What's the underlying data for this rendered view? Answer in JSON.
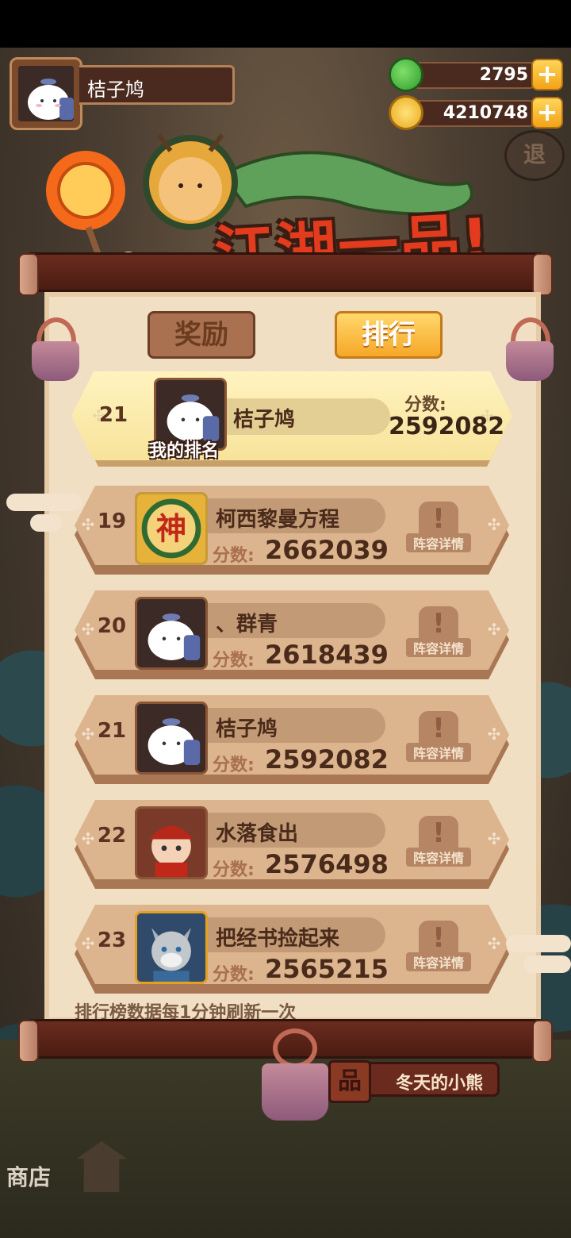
{
  "player": {
    "name": "桔子鸠"
  },
  "resources": {
    "jade": "2795",
    "coins": "4210748"
  },
  "back_label": "退",
  "banner_title": "江湖一品!",
  "tabs": {
    "reward": "奖励",
    "rank": "排行"
  },
  "my_rank": {
    "rank": "21",
    "name": "桔子鸠",
    "score_label": "分数:",
    "score": "2592082",
    "caption": "我的排名"
  },
  "score_label": "分数:",
  "detail_label": "阵容详情",
  "leaderboard": [
    {
      "rank": "19",
      "name": "柯西黎曼方程",
      "score": "2662039",
      "avatar": "shen-badge"
    },
    {
      "rank": "20",
      "name": "、群青",
      "score": "2618439",
      "avatar": "white-cat"
    },
    {
      "rank": "21",
      "name": "桔子鸠",
      "score": "2592082",
      "avatar": "white-cat"
    },
    {
      "rank": "22",
      "name": "水落食出",
      "score": "2576498",
      "avatar": "red-hero"
    },
    {
      "rank": "23",
      "name": "把经书捡起来",
      "score": "2565215",
      "avatar": "wolf-hero"
    }
  ],
  "refresh_note": "排行榜数据每1分钟刷新一次",
  "bottom": {
    "badge": "品",
    "label": "冬天的小熊",
    "shop": "商店"
  },
  "colors": {
    "accent": "#f6a728",
    "title_red": "#e23b1e",
    "paper": "#f1dfc3"
  }
}
